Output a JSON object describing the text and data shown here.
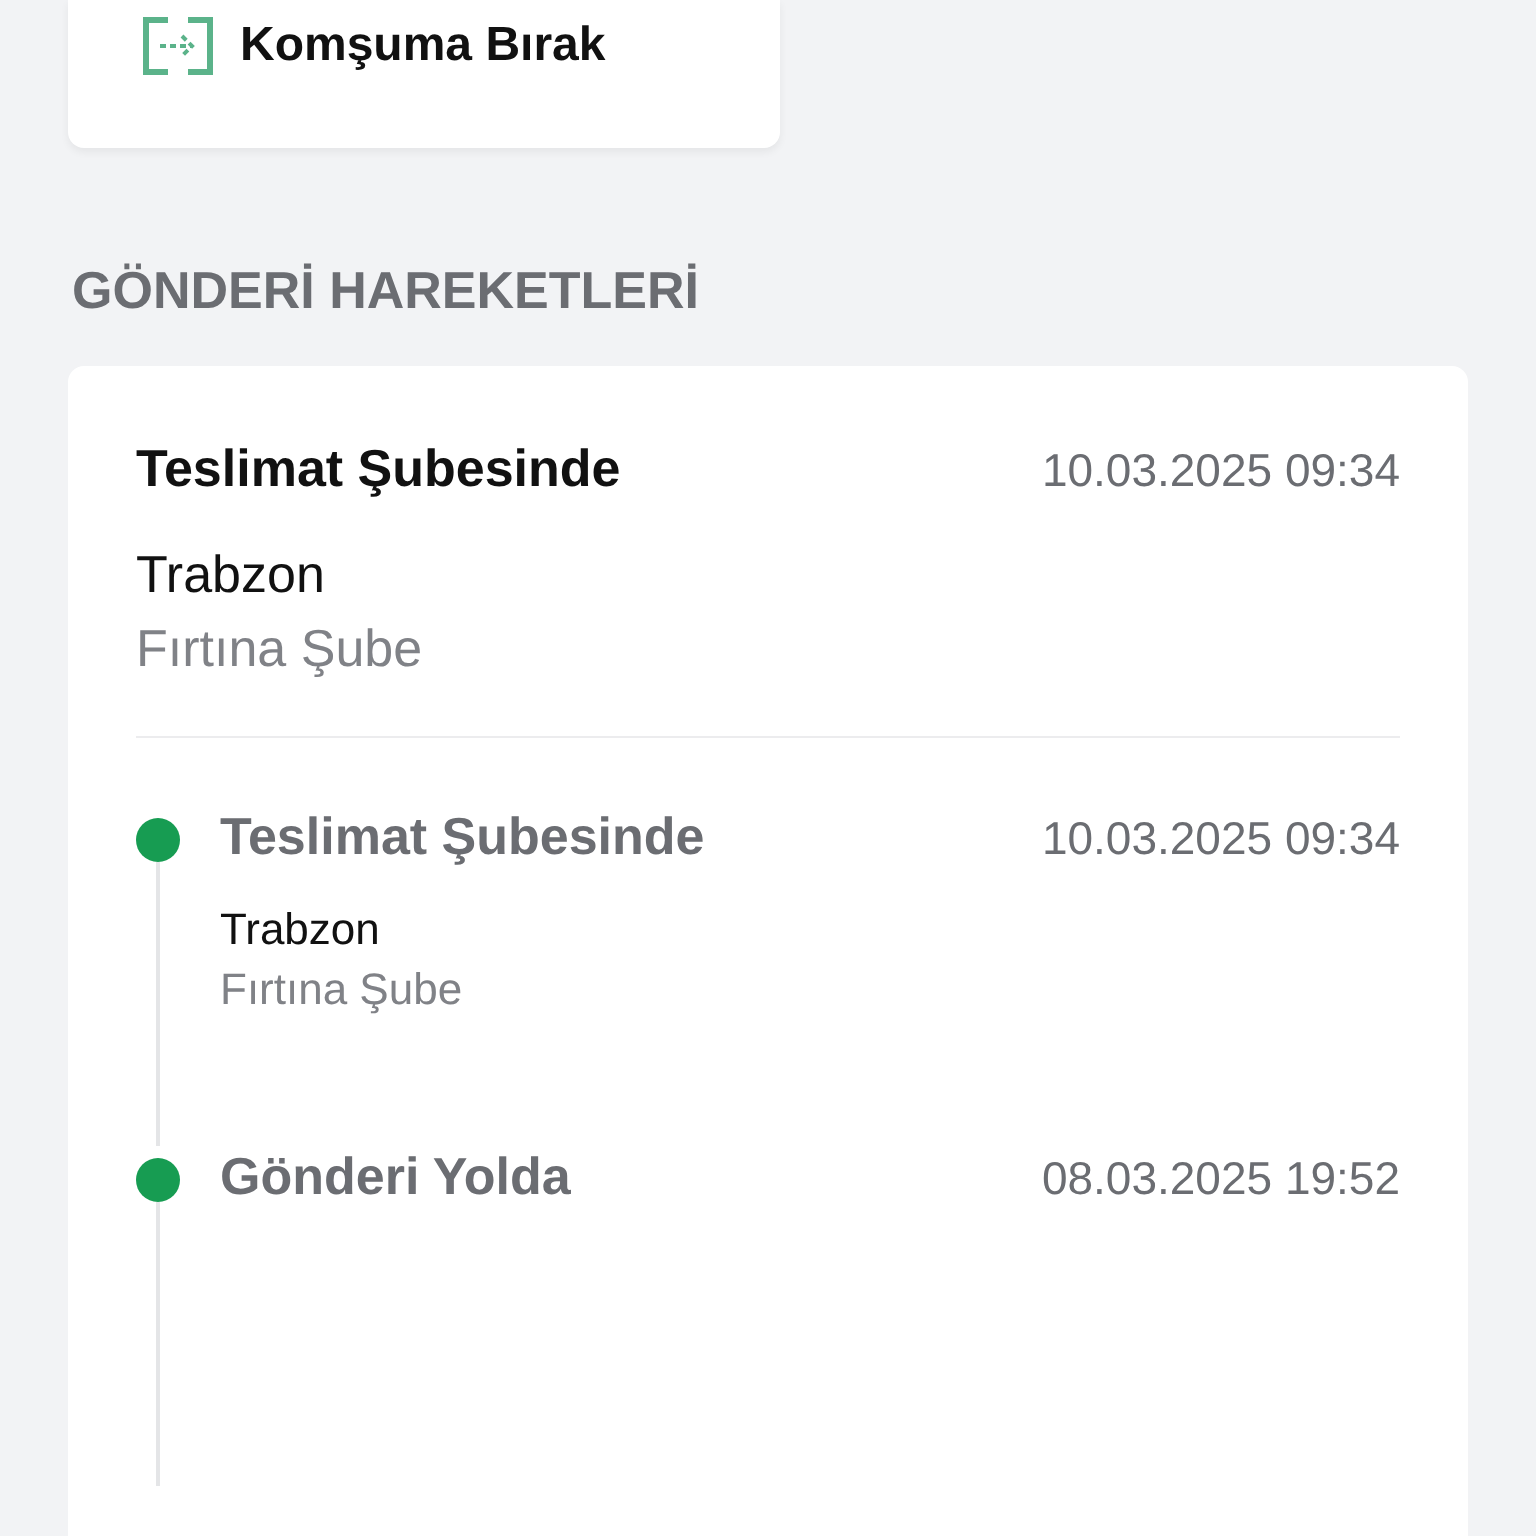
{
  "action": {
    "label": "Komşuma Bırak"
  },
  "section_title": "GÖNDERİ HAREKETLERİ",
  "current": {
    "status": "Teslimat Şubesinde",
    "time": "10.03.2025 09:34",
    "city": "Trabzon",
    "branch": "Fırtına Şube"
  },
  "events": [
    {
      "status": "Teslimat Şubesinde",
      "time": "10.03.2025 09:34",
      "city": "Trabzon",
      "branch": "Fırtına Şube"
    },
    {
      "status": "Gönderi Yolda",
      "time": "08.03.2025 19:52"
    }
  ]
}
